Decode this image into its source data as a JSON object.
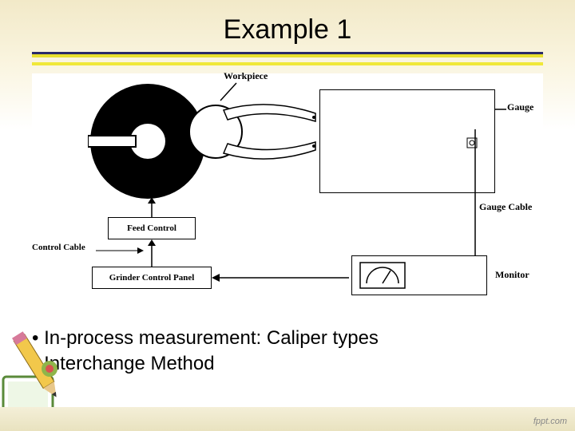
{
  "title": "Example 1",
  "diagram": {
    "labels": {
      "workpiece": "Workpiece",
      "gauge": "Gauge",
      "gauge_cable": "Gauge Cable",
      "feed_control": "Feed Control",
      "control_cable": "Control Cable",
      "grinder_panel": "Grinder Control Panel",
      "monitor": "Monitor"
    }
  },
  "bullets": [
    "In-process measurement: Caliper types",
    "Interchange Method"
  ],
  "footer": "fppt.com"
}
